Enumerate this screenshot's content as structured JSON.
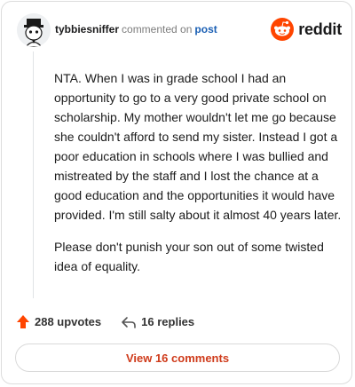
{
  "comment": {
    "username": "tybbiesniffer",
    "action_text": "commented on",
    "post_link": "post",
    "paragraphs": [
      "NTA. When I was in grade school I had an opportunity to go to a very good private school on scholarship. My mother wouldn't let me go because she couldn't afford to send my sister. Instead I got a poor education in schools where I was bullied and mistreated by the staff and I lost the chance at a good education and the opportunities it would have provided. I'm still salty about it almost 40 years later.",
      "Please don't punish your son out of some twisted idea of equality."
    ],
    "upvotes_label": "288 upvotes",
    "replies_label": "16 replies",
    "view_comments_label": "View 16 comments"
  },
  "brand": {
    "name": "reddit",
    "accent_color": "#ff4500"
  },
  "icons": {
    "upvote": "upvote-arrow-icon",
    "reply": "reply-arrow-icon",
    "avatar": "avatar-icon",
    "brand": "reddit-logo-icon"
  }
}
